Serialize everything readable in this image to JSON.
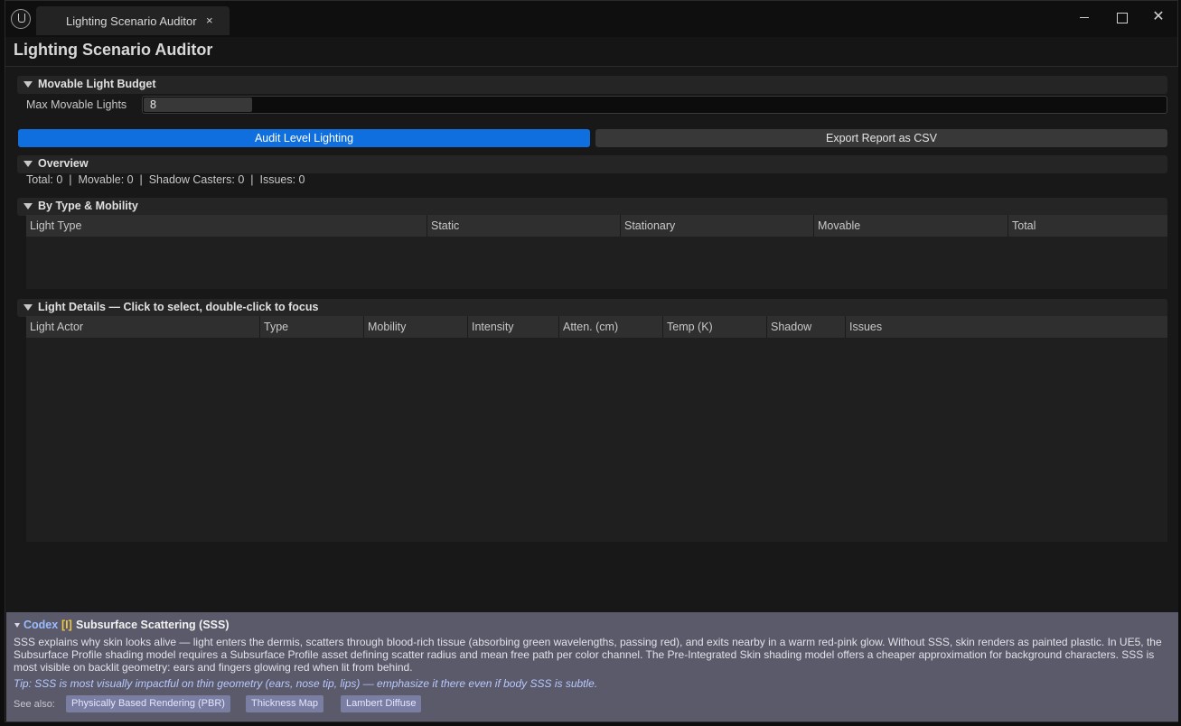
{
  "window": {
    "tab_label": "Lighting Scenario Auditor",
    "tab_close": "×",
    "close_glyph": "✕"
  },
  "panel": {
    "title": "Lighting Scenario Auditor"
  },
  "budget": {
    "section_title": "Movable Light Budget",
    "max_label": "Max Movable Lights",
    "max_value": "8"
  },
  "actions": {
    "audit_label": "Audit Level Lighting",
    "export_label": "Export Report as CSV"
  },
  "overview": {
    "section_title": "Overview",
    "summary": "Total: 0  |  Movable: 0  |  Shadow Casters: 0  |  Issues: 0"
  },
  "by_type": {
    "section_title": "By Type & Mobility",
    "columns": [
      "Light Type",
      "Static",
      "Stationary",
      "Movable",
      "Total"
    ],
    "rows": []
  },
  "details": {
    "section_title": "Light Details — Click to select, double-click to focus",
    "columns": [
      "Light Actor",
      "Type",
      "Mobility",
      "Intensity",
      "Atten. (cm)",
      "Temp (K)",
      "Shadow",
      "Issues"
    ],
    "rows": []
  },
  "codex": {
    "tag": "Codex",
    "badge": "[I]",
    "title": "Subsurface Scattering (SSS)",
    "body": "SSS explains why skin looks alive — light enters the dermis, scatters through blood-rich tissue (absorbing green wavelengths, passing red), and exits nearby in a warm red-pink glow. Without SSS, skin renders as painted plastic. In UE5, the Subsurface Profile shading model requires a Subsurface Profile asset defining scatter radius and mean free path per color channel. The Pre-Integrated Skin shading model offers a cheaper approximation for background characters. SSS is most visible on backlit geometry: ears and fingers glowing red when lit from behind.",
    "tip": "Tip: SSS is most visually impactful on thin geometry (ears, nose tip, lips) — emphasize it there even if body SSS is subtle.",
    "see_also_label": "See also:",
    "see_also": [
      "Physically Based Rendering (PBR)",
      "Thickness Map",
      "Lambert Diffuse"
    ]
  },
  "colors": {
    "accent": "#0f6fde",
    "codex_bg": "#5a5a6a",
    "codex_tag": "#9bbcff",
    "codex_badge": "#f0c840"
  }
}
